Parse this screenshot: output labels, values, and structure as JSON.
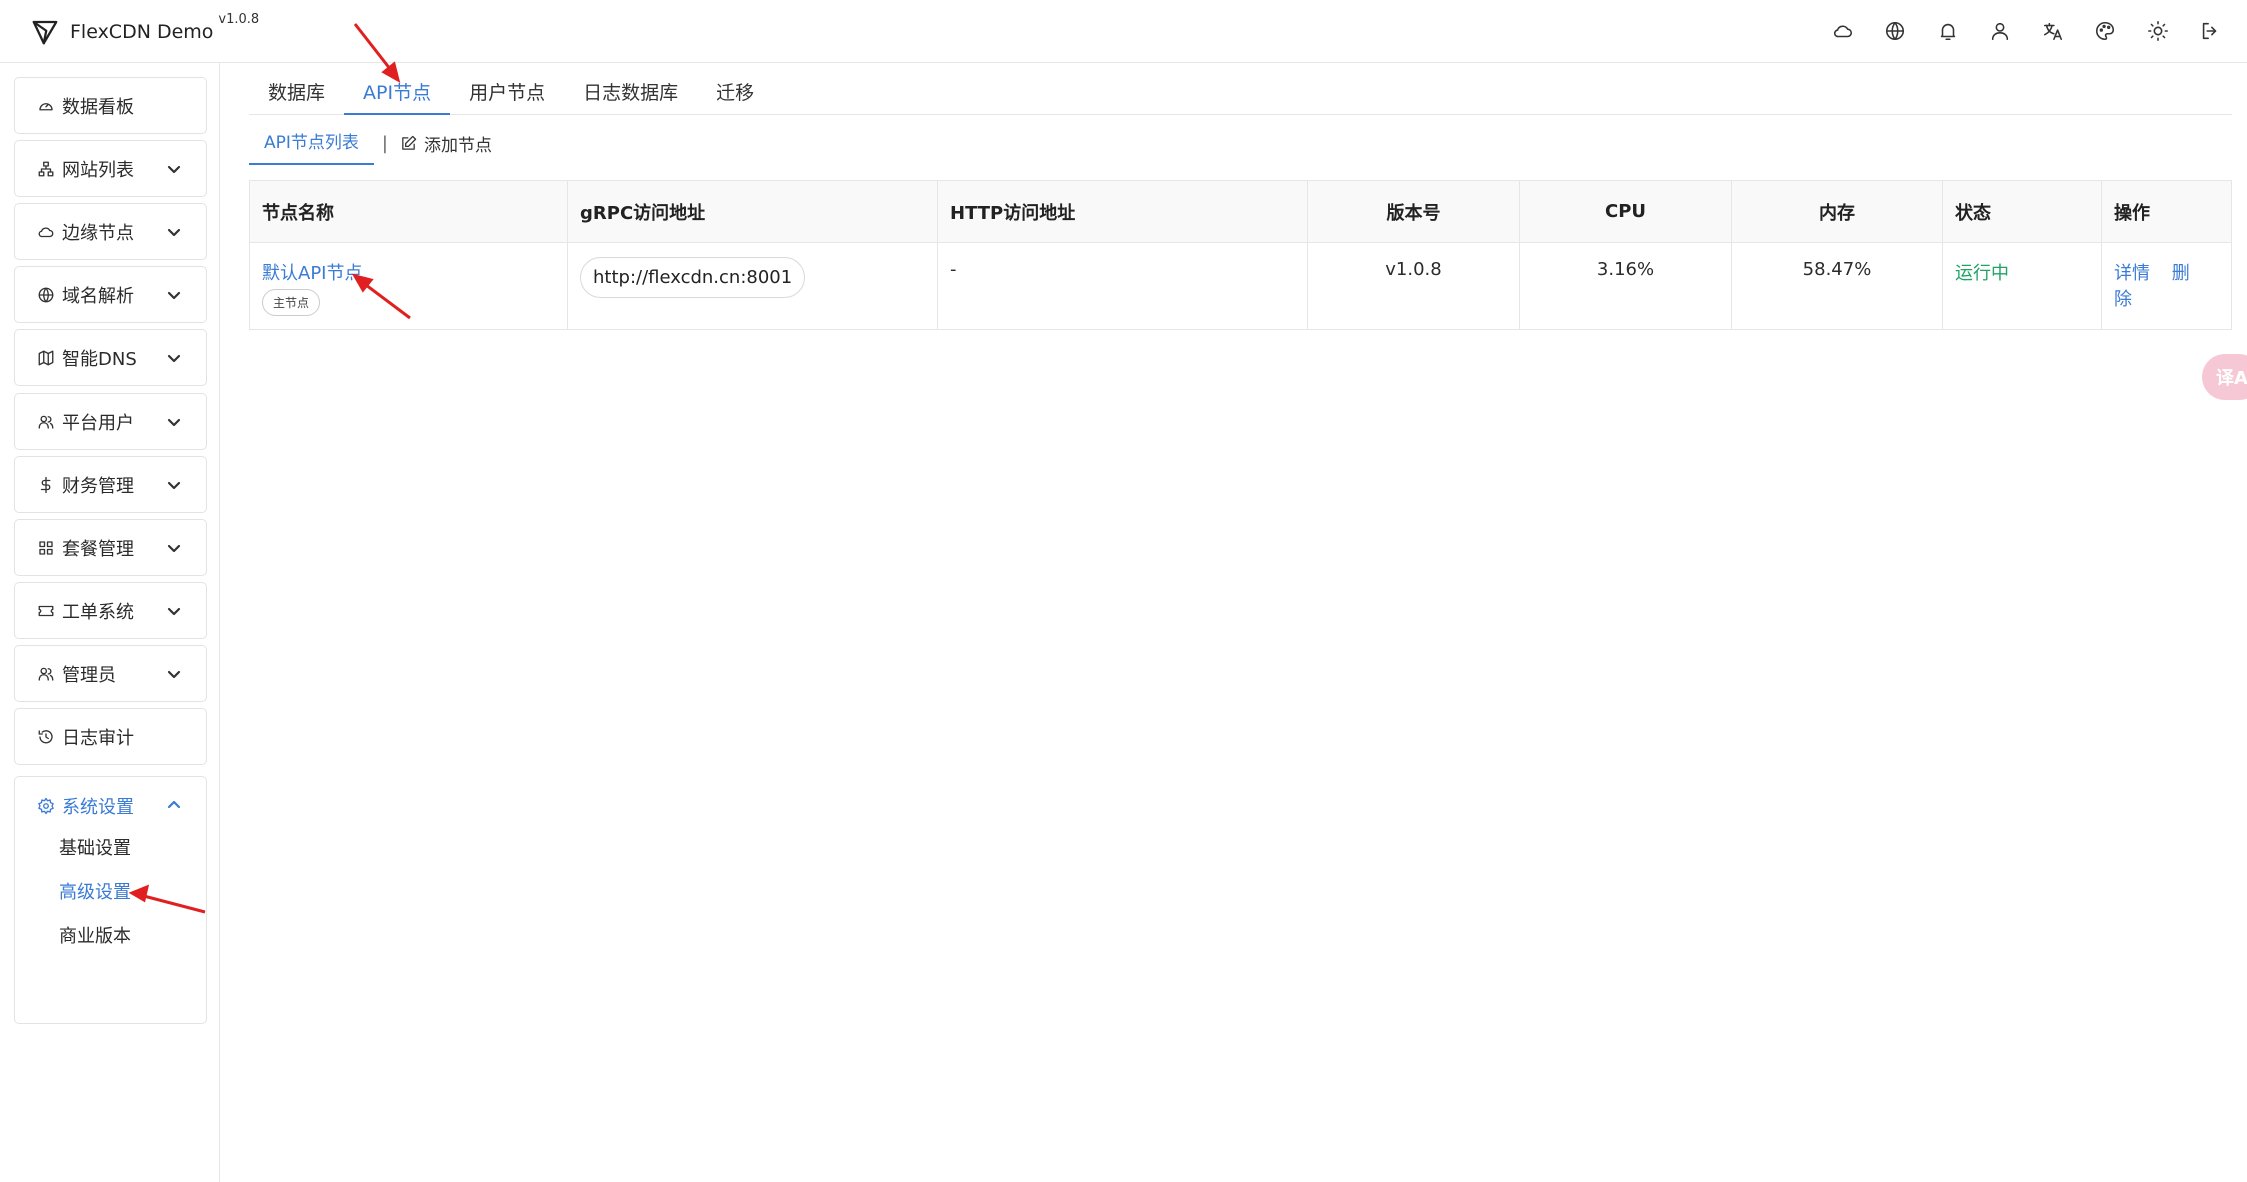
{
  "app": {
    "title": "FlexCDN Demo",
    "version": "v1.0.8"
  },
  "top_icons": [
    "cloud-icon",
    "globe-icon",
    "bell-icon",
    "user-icon",
    "translate-icon",
    "palette-icon",
    "sun-icon",
    "logout-icon"
  ],
  "sidebar": {
    "items": [
      {
        "label": "数据看板",
        "icon": "dashboard-icon",
        "expandable": false
      },
      {
        "label": "网站列表",
        "icon": "sitemap-icon",
        "expandable": true
      },
      {
        "label": "边缘节点",
        "icon": "cloud-icon",
        "expandable": true
      },
      {
        "label": "域名解析",
        "icon": "globe-icon",
        "expandable": true
      },
      {
        "label": "智能DNS",
        "icon": "map-icon",
        "expandable": true
      },
      {
        "label": "平台用户",
        "icon": "users-icon",
        "expandable": true
      },
      {
        "label": "财务管理",
        "icon": "dollar-icon",
        "expandable": true
      },
      {
        "label": "套餐管理",
        "icon": "grid-icon",
        "expandable": true
      },
      {
        "label": "工单系统",
        "icon": "ticket-icon",
        "expandable": true
      },
      {
        "label": "管理员",
        "icon": "users-icon",
        "expandable": true
      },
      {
        "label": "日志审计",
        "icon": "history-icon",
        "expandable": false
      }
    ],
    "settings": {
      "label": "系统设置",
      "icon": "gear-icon",
      "children": [
        {
          "label": "基础设置",
          "active": false
        },
        {
          "label": "高级设置",
          "active": true
        },
        {
          "label": "商业版本",
          "active": false
        }
      ]
    }
  },
  "tabs": [
    {
      "label": "数据库",
      "active": false
    },
    {
      "label": "API节点",
      "active": true
    },
    {
      "label": "用户节点",
      "active": false
    },
    {
      "label": "日志数据库",
      "active": false
    },
    {
      "label": "迁移",
      "active": false
    }
  ],
  "subtabs": {
    "list": "API节点列表",
    "separator": "|",
    "add": "添加节点"
  },
  "table": {
    "headers": [
      "节点名称",
      "gRPC访问地址",
      "HTTP访问地址",
      "版本号",
      "CPU",
      "内存",
      "状态",
      "操作"
    ],
    "rows": [
      {
        "name": "默认API节点",
        "badge": "主节点",
        "grpc": "http://flexcdn.cn:8001",
        "http": "-",
        "version": "v1.0.8",
        "cpu": "3.16%",
        "memory": "58.47%",
        "status": "运行中",
        "actions": {
          "detail": "详情",
          "delete": "删除"
        }
      }
    ]
  },
  "float_button": {
    "label": "译A",
    "color": "#f6c8d6"
  },
  "colors": {
    "accent": "#3a7bd5",
    "running": "#21a366",
    "annotation_arrow": "#e02020"
  }
}
